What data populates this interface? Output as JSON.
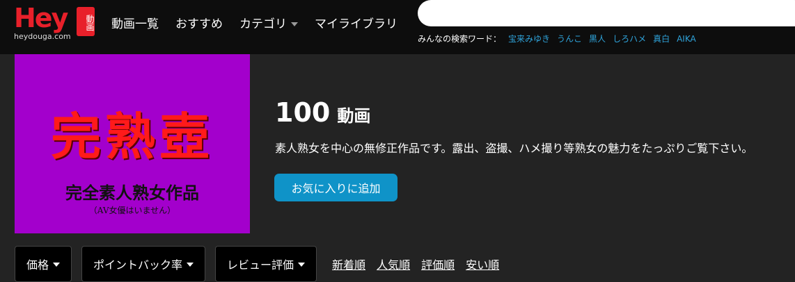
{
  "header": {
    "logo_text": "Hey",
    "logo_badge": "動画",
    "logo_sub": "heydouga.com",
    "nav": [
      {
        "label": "動画一覧"
      },
      {
        "label": "おすすめ"
      },
      {
        "label": "カテゴリ"
      },
      {
        "label": "マイライブラリ"
      }
    ],
    "search_placeholder": "",
    "popular_label": "みんなの検索ワード：",
    "popular_words": [
      "宝来みゆき",
      "うんこ",
      "黒人",
      "しろハメ",
      "真白",
      "AIKA"
    ]
  },
  "banner": {
    "title": "完熟壺",
    "subtitle": "完全素人熟女作品",
    "note": "（AV女優はいません）"
  },
  "info": {
    "count": "100",
    "count_unit": "動画",
    "description": "素人熟女を中心の無修正作品です。露出、盗撮、ハメ撮り等熟女の魅力をたっぷりご覧下さい。",
    "favorite_button": "お気に入りに追加"
  },
  "filters": {
    "buttons": [
      "価格",
      "ポイントバック率",
      "レビュー評価"
    ],
    "sort_links": [
      "新着順",
      "人気順",
      "評価順",
      "安い順"
    ]
  },
  "colors": {
    "accent_blue": "#0f93c8",
    "link_blue": "#2fa3da",
    "logo_red": "#e8202a",
    "banner_bg": "#a300cc"
  }
}
